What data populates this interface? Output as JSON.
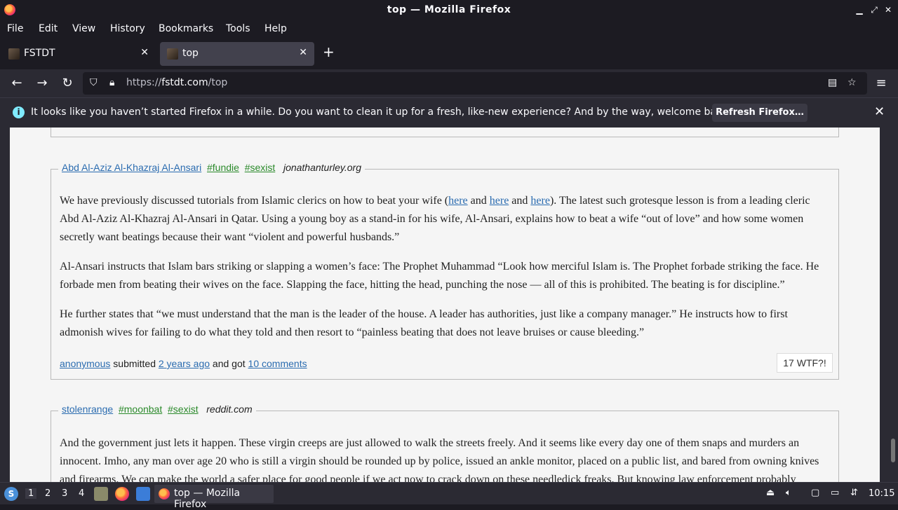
{
  "window": {
    "title": "top — Mozilla Firefox"
  },
  "menubar": [
    "File",
    "Edit",
    "View",
    "History",
    "Bookmarks",
    "Tools",
    "Help"
  ],
  "tabs": [
    {
      "label": "FSTDT",
      "active": false
    },
    {
      "label": "top",
      "active": true
    }
  ],
  "navbar": {
    "url_scheme": "https://",
    "url_domain": "fstdt.com",
    "url_path": "/top"
  },
  "notification": {
    "message": "It looks like you haven’t started Firefox in a while. Do you want to clean it up for a fresh, like-new experience? And by the way, welcome back!",
    "button": "Refresh Firefox…"
  },
  "quotes": [
    {
      "author": "Abd Al-Aziz Al-Khazraj Al-Ansari",
      "tags": [
        "#fundie",
        "#sexist"
      ],
      "site": "jonathanturley.org",
      "p1_a": "We have previously discussed tutorials from Islamic clerics on how to beat your wife (",
      "link1": "here",
      "and1": " and ",
      "link2": "here",
      "and2": " and ",
      "link3": "here",
      "p1_b": "). The latest such grotesque lesson is from a leading cleric Abd Al-Aziz Al-Khazraj Al-Ansari in Qatar. Using a young boy as a stand-in for his wife, Al-Ansari, explains how to beat a wife “out of love” and how some women secretly want beatings because their want “violent and powerful husbands.”",
      "p2": "Al-Ansari instructs that Islam bars striking or slapping a women’s face: The Prophet Muhammad “Look how merciful Islam is. The Prophet forbade striking the face. He forbade men from beating their wives on the face. Slapping the face, hitting the head, punching the nose — all of this is prohibited. The beating is for discipline.”",
      "p3": "He further states that “we must understand that the man is the leader of the house. A leader has authorities, just like a company manager.” He instructs how to first admonish wives for failing to do what they told and then resort to “painless beating that does not leave bruises or cause bleeding.”",
      "submitter": "anonymous",
      "submitted_word": " submitted ",
      "time": "2 years ago",
      "got_word": " and got ",
      "comments": "10 comments",
      "wtf": "17 WTF?!"
    },
    {
      "author": "stolenrange",
      "tags": [
        "#moonbat",
        "#sexist"
      ],
      "site": "reddit.com",
      "p1": "And the government just lets it happen. These virgin creeps are just allowed to walk the streets freely. And it seems like every day one of them snaps and murders an innocent. Imho, any man over age 20 who is still a virgin should be rounded up by police, issued an ankle monitor, placed on a public list, and bared from owning knives and firearms. We can make the world a safer place for good people if we act now to crack down on these needledick freaks. But knowing law enforcement probably"
    }
  ],
  "taskbar": {
    "workspaces": [
      "1",
      "2",
      "3",
      "4"
    ],
    "window_label": "top — Mozilla Firefox",
    "clock": "10:15"
  }
}
